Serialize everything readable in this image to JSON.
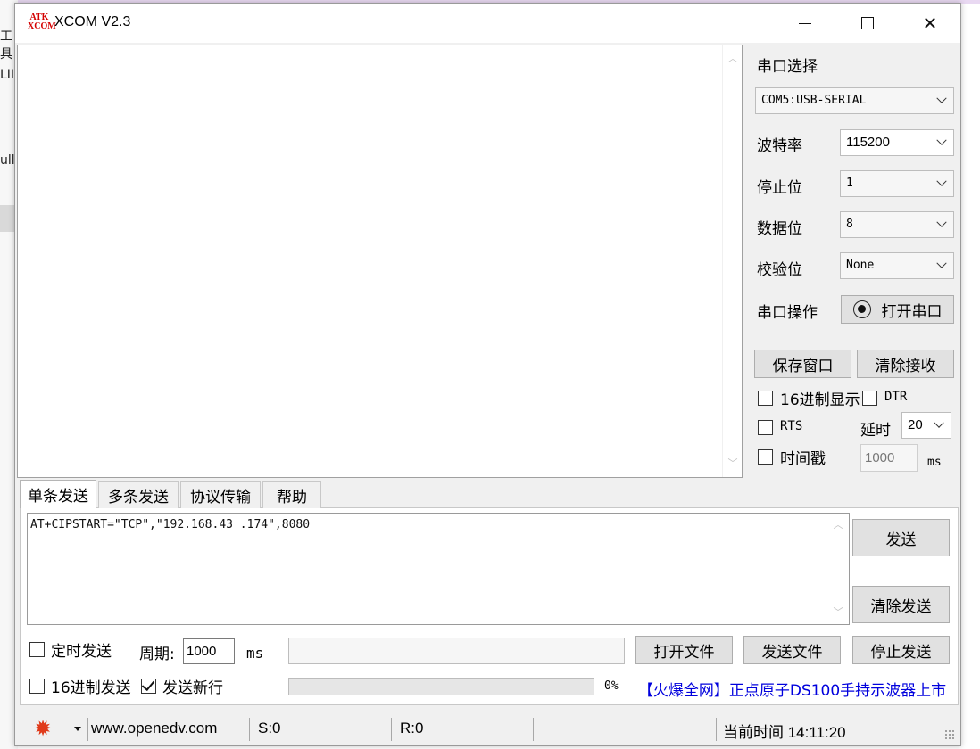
{
  "background": {
    "texts": [
      "工具",
      "LII",
      "ull"
    ]
  },
  "window": {
    "title": "XCOM V2.3",
    "logo_text": "ATK XCOM",
    "close_glyph": "✕"
  },
  "serial_panel": {
    "port_select_label": "串口选择",
    "port_value": "COM5:USB-SERIAL",
    "baud_label": "波特率",
    "baud_value": "115200",
    "stop_bits_label": "停止位",
    "stop_bits_value": "1",
    "data_bits_label": "数据位",
    "data_bits_value": "8",
    "parity_label": "校验位",
    "parity_value": "None",
    "port_op_label": "串口操作",
    "open_port_button": "打开串口",
    "save_window_button": "保存窗口",
    "clear_receive_button": "清除接收",
    "hex_display_label": "16进制显示",
    "dtr_label": "DTR",
    "rts_label": "RTS",
    "delay_label": "延时",
    "delay_value": "20",
    "timestamp_label": "时间戳",
    "timestamp_value": "1000",
    "ms_label": "ms"
  },
  "tabs": [
    {
      "label": "单条发送",
      "active": true
    },
    {
      "label": "多条发送",
      "active": false
    },
    {
      "label": "协议传输",
      "active": false
    },
    {
      "label": "帮助",
      "active": false
    }
  ],
  "send": {
    "text": "AT+CIPSTART=\"TCP\",\"192.168.43 .174\",8080",
    "send_button": "发送",
    "clear_send_button": "清除发送",
    "timed_send_label": "定时发送",
    "period_label": "周期:",
    "period_value": "1000",
    "period_unit": "ms",
    "open_file_button": "打开文件",
    "send_file_button": "发送文件",
    "stop_send_button": "停止发送",
    "hex_send_label": "16进制发送",
    "send_newline_label": "发送新行",
    "send_newline_checked": true,
    "progress_percent": "0%",
    "promo_text": "【火爆全网】正点原子DS100手持示波器上市"
  },
  "status_bar": {
    "website": "www.openedv.com",
    "sent": "S:0",
    "received": "R:0",
    "current_time": "当前时间 14:11:20"
  },
  "colors": {
    "accent_red": "#e03a1a",
    "promo_blue": "#0000dd"
  }
}
